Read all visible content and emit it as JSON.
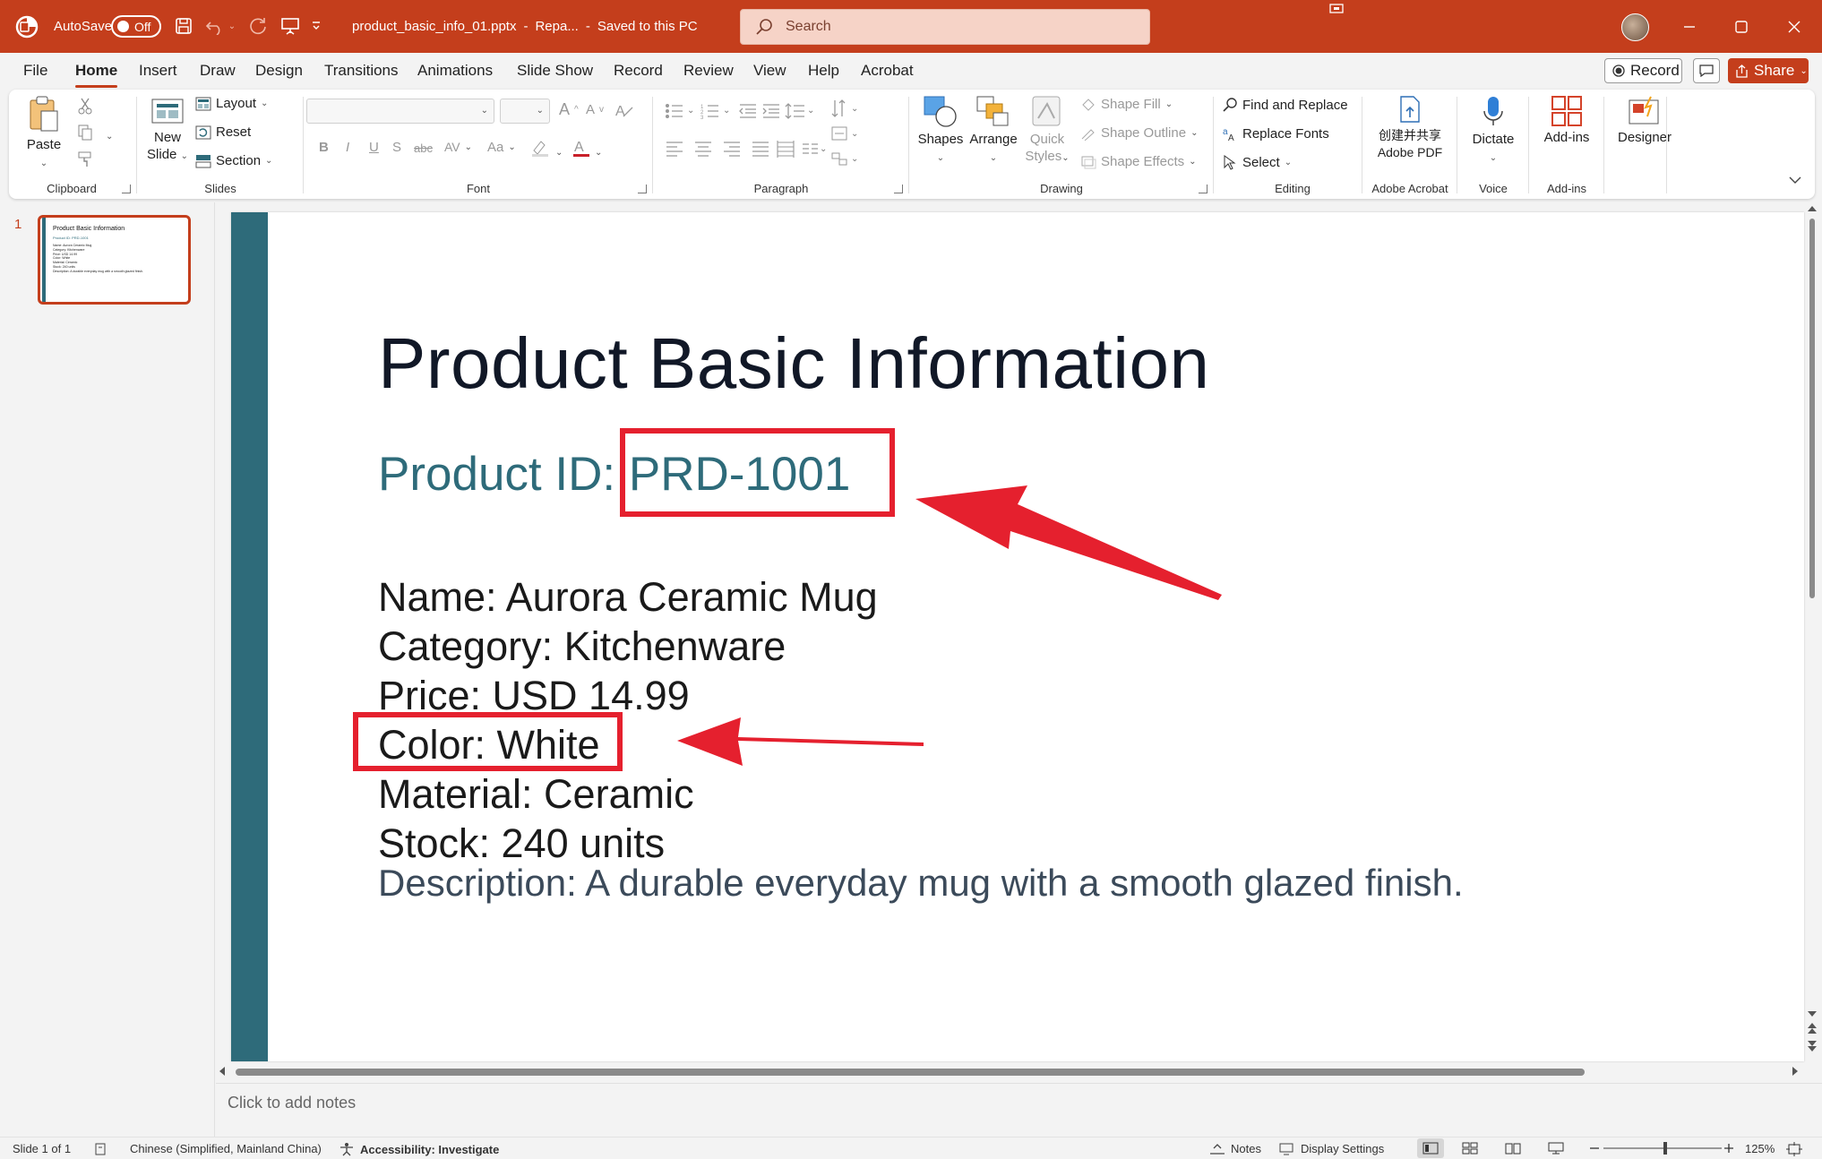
{
  "titlebar": {
    "autosave_label": "AutoSave",
    "autosave_state": "Off",
    "doc_name": "product_basic_info_01.pptx",
    "doc_status_sep": "-",
    "doc_status_short": "Repa...",
    "saved_status": "Saved to this PC",
    "search_placeholder": "Search",
    "accent_color": "#c43e1c"
  },
  "tabs": {
    "items": [
      "File",
      "Home",
      "Insert",
      "Draw",
      "Design",
      "Transitions",
      "Animations",
      "Slide Show",
      "Record",
      "Review",
      "View",
      "Help",
      "Acrobat"
    ],
    "active": "Home",
    "record_button": "Record",
    "share_button": "Share"
  },
  "ribbon": {
    "clipboard": {
      "label": "Clipboard",
      "paste": "Paste"
    },
    "slides": {
      "label": "Slides",
      "new_slide_line1": "New",
      "new_slide_line2": "Slide",
      "layout": "Layout",
      "reset": "Reset",
      "section": "Section"
    },
    "font": {
      "label": "Font",
      "bold": "B",
      "italic": "I",
      "underline": "U",
      "shadow": "S",
      "strike": "abc",
      "spacing": "AV",
      "case": "Aa",
      "grow": "A",
      "shrink": "A"
    },
    "paragraph": {
      "label": "Paragraph"
    },
    "drawing": {
      "label": "Drawing",
      "shapes": "Shapes",
      "arrange": "Arrange",
      "quick_styles_line1": "Quick",
      "quick_styles_line2": "Styles",
      "shape_fill": "Shape Fill",
      "shape_outline": "Shape Outline",
      "shape_effects": "Shape Effects"
    },
    "editing": {
      "label": "Editing",
      "find_replace": "Find and Replace",
      "replace_fonts": "Replace Fonts",
      "select": "Select"
    },
    "acrobat": {
      "label": "Adobe Acrobat",
      "line1": "创建并共享",
      "line2": "Adobe PDF"
    },
    "voice": {
      "label": "Voice",
      "dictate": "Dictate"
    },
    "addins": {
      "label": "Add-ins",
      "addins": "Add-ins"
    },
    "designer": {
      "designer": "Designer"
    }
  },
  "thumbnails": {
    "slide_number": "1",
    "mini_title": "Product Basic Information",
    "mini_id": "Product ID: PRD-1001",
    "mini_lines": [
      "Name: Aurora Ceramic Mug",
      "Category: Kitchenware",
      "Price: USD 14.99",
      "Color: White",
      "Material: Ceramic",
      "Stock: 240 units",
      "Description: A durable everyday mug with a smooth glazed finish."
    ]
  },
  "slide": {
    "title": "Product Basic Information",
    "product_id_label": "Product ID: ",
    "product_id_value": "PRD-1001",
    "name": "Name: Aurora Ceramic Mug",
    "category": "Category: Kitchenware",
    "price": "Price: USD 14.99",
    "color": "Color: White",
    "material": "Material: Ceramic",
    "stock": "Stock: 240 units",
    "description": "Description: A durable everyday mug with a smooth glazed finish.",
    "accent_color": "#2e6b7a",
    "annotation_color": "#e5202e"
  },
  "notes": {
    "placeholder": "Click to add notes"
  },
  "statusbar": {
    "slide_count": "Slide 1 of 1",
    "language": "Chinese (Simplified, Mainland China)",
    "accessibility": "Accessibility: Investigate",
    "notes": "Notes",
    "display_settings": "Display Settings",
    "zoom": "125%",
    "zoom_fraction": 0.52
  }
}
